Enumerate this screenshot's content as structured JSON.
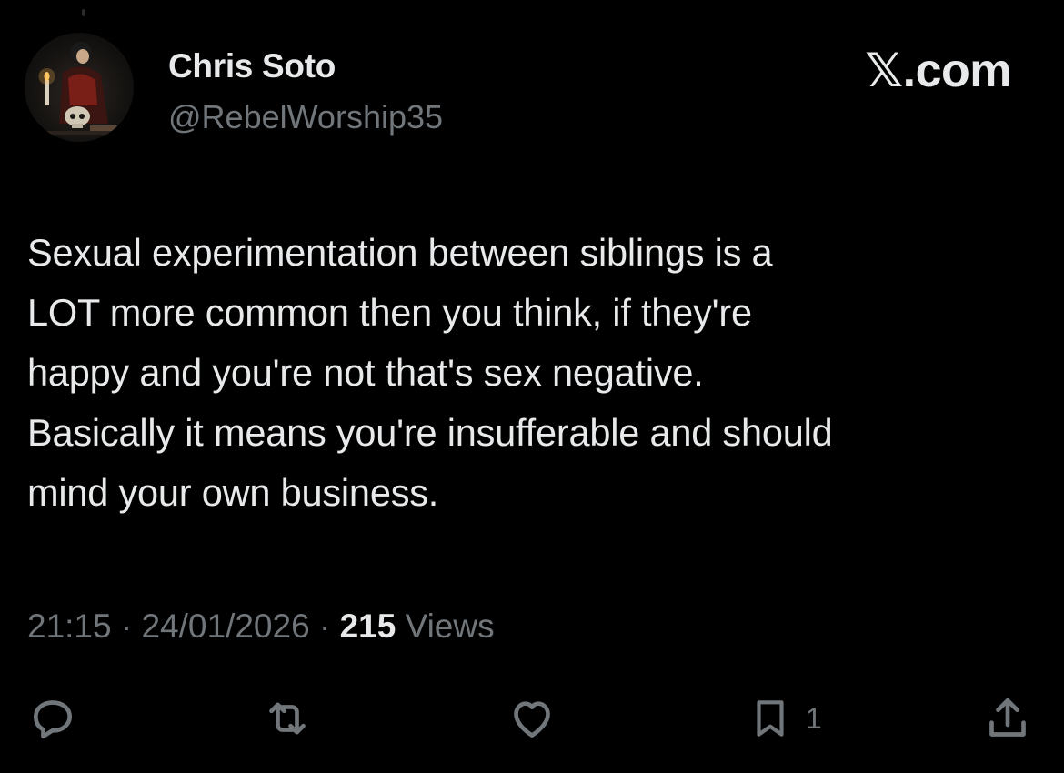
{
  "author": {
    "name": "Chris Soto",
    "handle": "@RebelWorship35",
    "avatar_icon": "avatar-icon"
  },
  "brand": {
    "logo_text": "𝕏.com"
  },
  "post": {
    "lines": [
      "Sexual experimentation between siblings is a",
      "LOT more common then you think, if they're",
      "happy and you're not that's sex negative.",
      "Basically it means you're insufferable and should",
      "mind your own business."
    ]
  },
  "meta": {
    "time": "21:15",
    "sep1": " · ",
    "date": "24/01/2026",
    "sep2": " · ",
    "views_count": "215",
    "views_label": " Views"
  },
  "actions": {
    "reply_icon": "reply-icon",
    "repost_icon": "repost-icon",
    "like_icon": "heart-icon",
    "bookmark_icon": "bookmark-icon",
    "bookmark_count": "1",
    "share_icon": "share-icon"
  },
  "colors": {
    "background": "#000000",
    "primary_text": "#e7e9ea",
    "secondary_text": "#71767b"
  }
}
